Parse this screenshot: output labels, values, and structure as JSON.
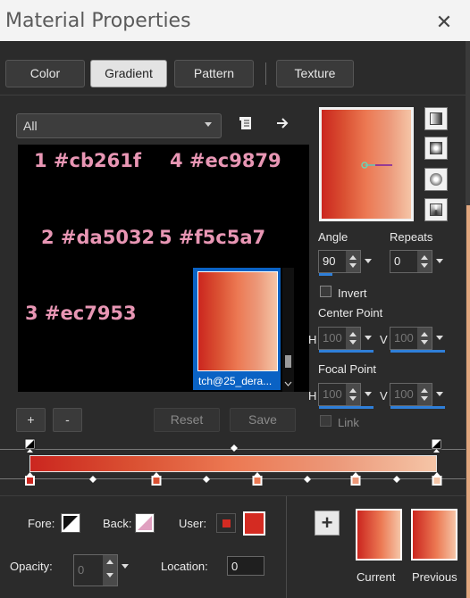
{
  "window": {
    "title": "Material Properties",
    "close_glyph": "✕"
  },
  "tabs": [
    {
      "label": "Color",
      "active": false
    },
    {
      "label": "Gradient",
      "active": true
    },
    {
      "label": "Pattern",
      "active": false
    },
    {
      "label": "Texture",
      "active": false
    }
  ],
  "library": {
    "filter_value": "All",
    "notes": [
      "1 #cb261f",
      "4 #ec9879",
      "2 #da5032",
      "5 #f5c5a7",
      "3 #ec7953"
    ],
    "selected_item_label": "tch@25_dera..."
  },
  "library_buttons": {
    "add": "+",
    "remove": "-",
    "reset": "Reset",
    "save": "Save"
  },
  "gradient_colors": [
    "#cb261f",
    "#da5032",
    "#ec7953",
    "#ec9879",
    "#f5c5a7"
  ],
  "settings": {
    "angle_label": "Angle",
    "angle_value": "90",
    "repeats_label": "Repeats",
    "repeats_value": "0",
    "invert_label": "Invert",
    "center_label": "Center Point",
    "center_h_label": "H",
    "center_h": "100",
    "center_v_label": "V",
    "center_v": "100",
    "focal_label": "Focal Point",
    "focal_h_label": "H",
    "focal_h": "100",
    "focal_v_label": "V",
    "focal_v": "100",
    "link_label": "Link"
  },
  "bottom": {
    "fore_label": "Fore:",
    "back_label": "Back:",
    "user_label": "User:",
    "user_color": "#d42b22",
    "opacity_label": "Opacity:",
    "opacity_value": "0",
    "location_label": "Location:",
    "location_value": "0",
    "add_glyph": "+",
    "current_label": "Current",
    "previous_label": "Previous"
  }
}
